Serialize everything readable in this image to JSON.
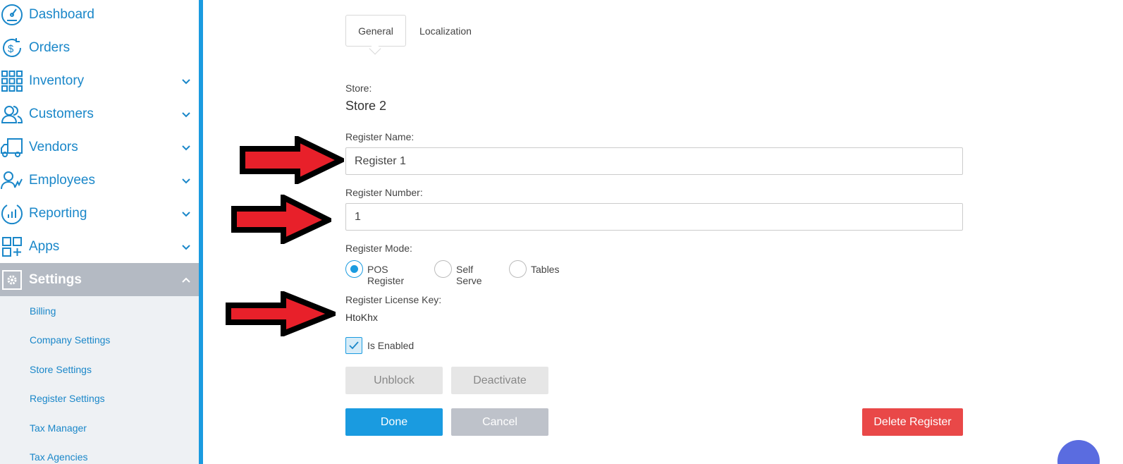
{
  "sidebar": {
    "items": [
      {
        "label": "Dashboard",
        "icon": "dashboard-icon"
      },
      {
        "label": "Orders",
        "icon": "dollar-icon"
      },
      {
        "label": "Inventory",
        "icon": "grid-icon"
      },
      {
        "label": "Customers",
        "icon": "users-icon"
      },
      {
        "label": "Vendors",
        "icon": "truck-icon"
      },
      {
        "label": "Employees",
        "icon": "employee-icon"
      },
      {
        "label": "Reporting",
        "icon": "chart-icon"
      },
      {
        "label": "Apps",
        "icon": "apps-icon"
      },
      {
        "label": "Settings",
        "icon": "gear-icon"
      }
    ],
    "submenu": [
      "Billing",
      "Company Settings",
      "Store Settings",
      "Register Settings",
      "Tax Manager",
      "Tax Agencies"
    ]
  },
  "tabs": {
    "general": "General",
    "localization": "Localization"
  },
  "form": {
    "store_label": "Store:",
    "store_value": "Store 2",
    "register_name_label": "Register Name:",
    "register_name_value": "Register 1",
    "register_number_label": "Register Number:",
    "register_number_value": "1",
    "register_mode_label": "Register Mode:",
    "modes": [
      "POS Register",
      "Self Serve",
      "Tables"
    ],
    "selected_mode": "POS Register",
    "license_key_label": "Register License Key:",
    "license_key_value": "HtoKhx",
    "is_enabled_label": "Is Enabled",
    "is_enabled": true
  },
  "buttons": {
    "unblock": "Unblock",
    "deactivate": "Deactivate",
    "done": "Done",
    "cancel": "Cancel",
    "delete_register": "Delete Register"
  },
  "colors": {
    "accent": "#1a9be0",
    "danger": "#e94848",
    "arrow_fill": "#e8202a"
  }
}
